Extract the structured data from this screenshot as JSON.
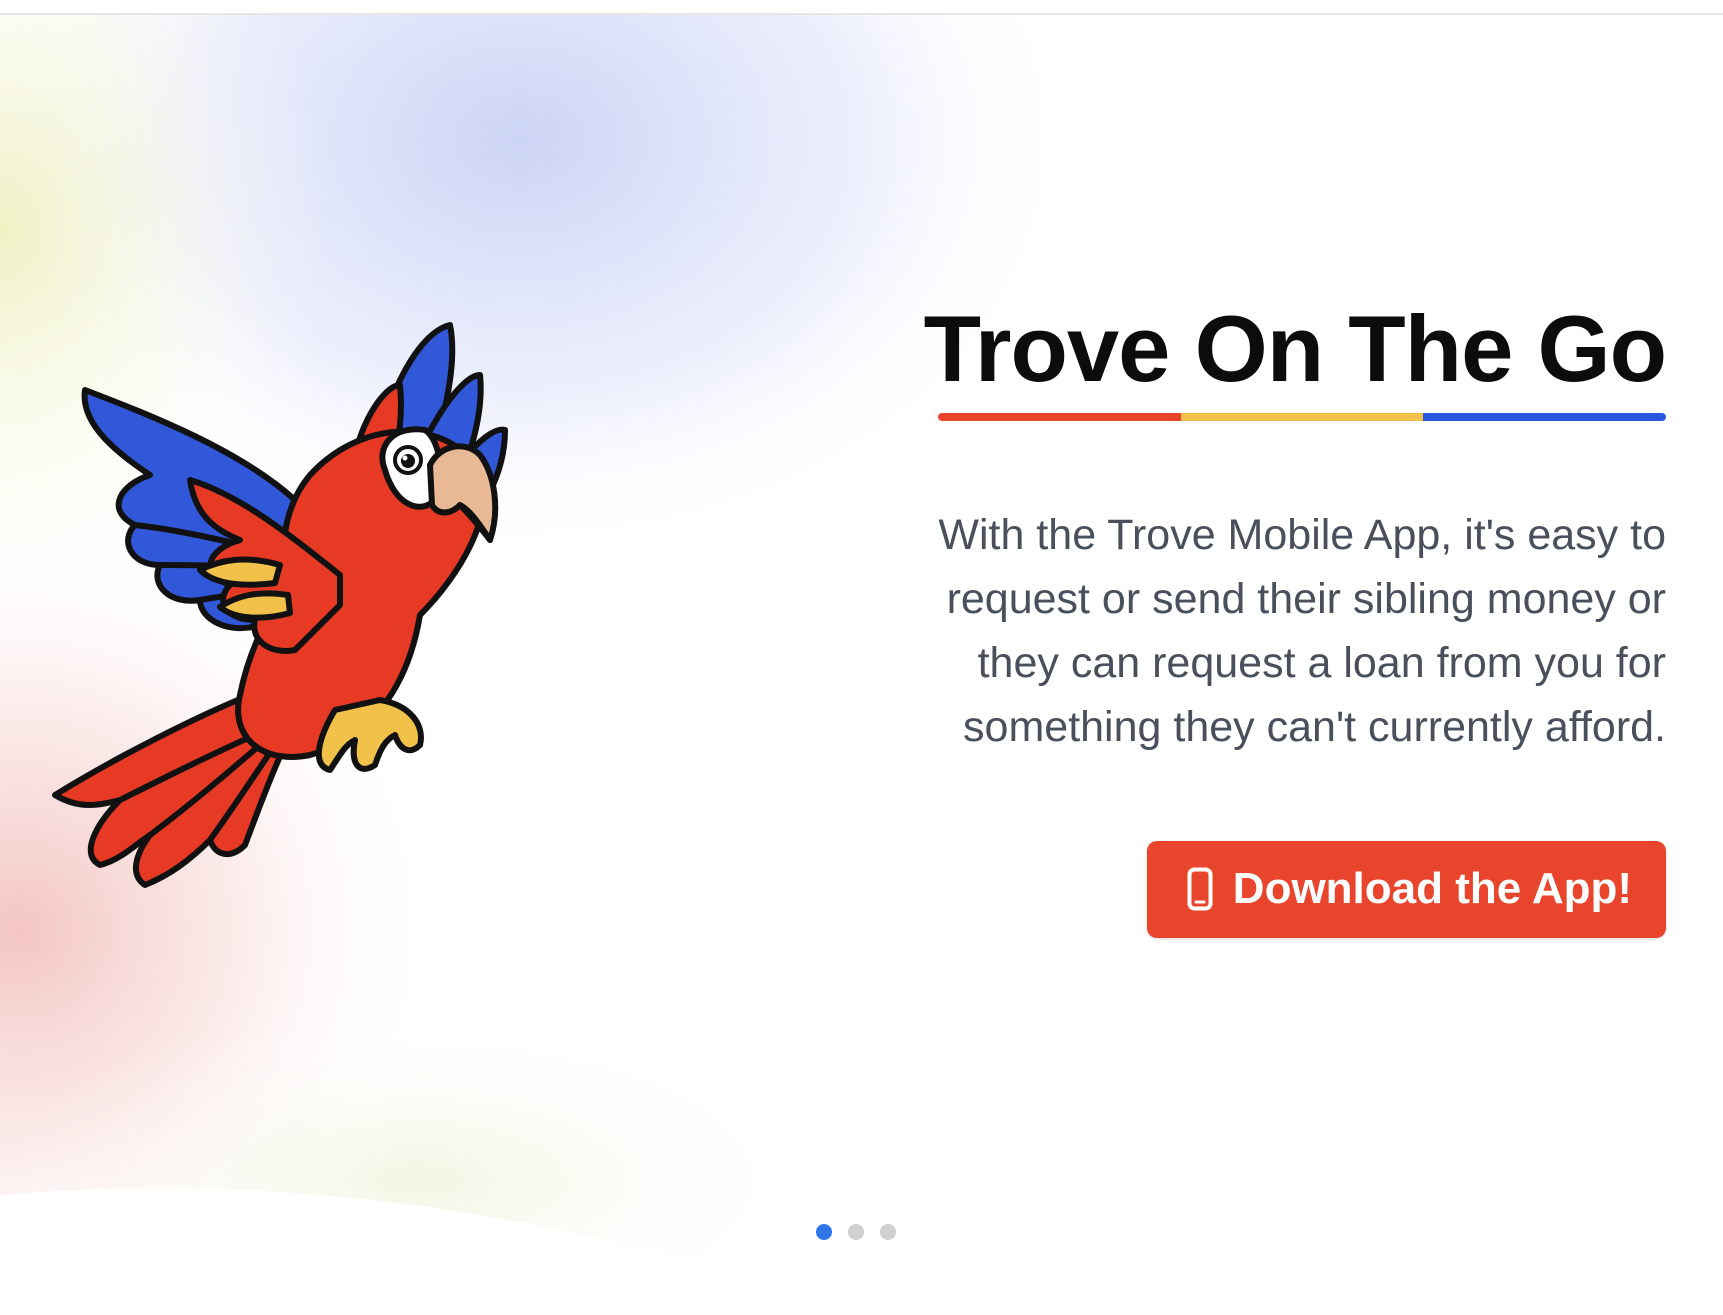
{
  "hero": {
    "title": "Trove On The Go",
    "description": "With the Trove Mobile App, it's easy to request or send their sibling money or they can request a loan from you for something they can't currently afford.",
    "button_label": "Download the App!",
    "button_icon": "mobile-phone-icon",
    "underline_colors": [
      "#e8452c",
      "#f2c14a",
      "#2b57e0"
    ]
  },
  "carousel": {
    "slides": 3,
    "active_index": 0
  },
  "colors": {
    "accent": "#e8452c",
    "title": "#0c0c0c",
    "body_text": "#4a4f5c",
    "dot_active": "#2f75e8",
    "dot_inactive": "#cfcfcf"
  }
}
